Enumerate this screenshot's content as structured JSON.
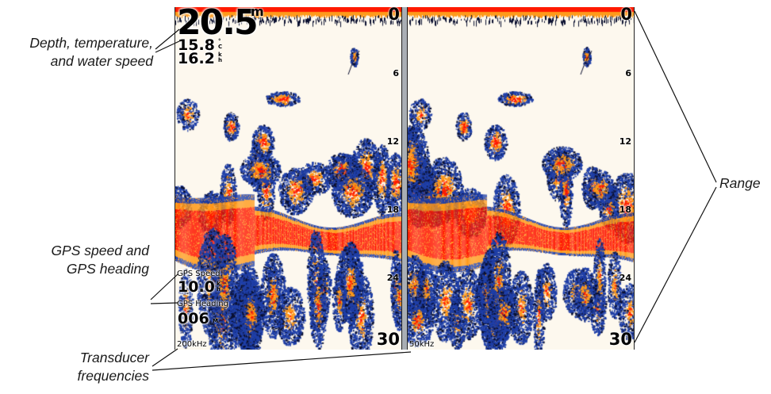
{
  "callouts": {
    "depth": [
      "Depth, temperature,",
      "and water speed"
    ],
    "gps": [
      "GPS speed and",
      "GPS heading"
    ],
    "transducer": [
      "Transducer",
      "frequencies"
    ],
    "range": "Range"
  },
  "left_panel": {
    "depth": "20.5",
    "depth_unit": "m",
    "temperature": "15.8",
    "temperature_unit": [
      "°",
      "C"
    ],
    "water_speed": "16.2",
    "water_speed_unit": [
      "k",
      "h"
    ],
    "gps_speed_label": "GPS Speed",
    "gps_speed": "10.0",
    "gps_speed_unit": [
      "k",
      "h"
    ],
    "gps_heading_label": "GPS Heading",
    "gps_heading": "006",
    "gps_heading_unit": [
      "°",
      "M"
    ],
    "frequency": "200kHz",
    "scale": [
      "0",
      "6",
      "12",
      "18",
      "24",
      "30"
    ]
  },
  "right_panel": {
    "frequency": "50kHz",
    "scale": [
      "0",
      "6",
      "12",
      "18",
      "24",
      "30"
    ]
  },
  "colors": {
    "background": "#fdf8ee",
    "strong_return": "#ff1a00",
    "medium_return": "#ff9a1a",
    "weak_return": "#1f3fa8",
    "divider": "#a9aeb4"
  },
  "icons": {
    "sonar_display": "sonar-echo-canvas"
  }
}
